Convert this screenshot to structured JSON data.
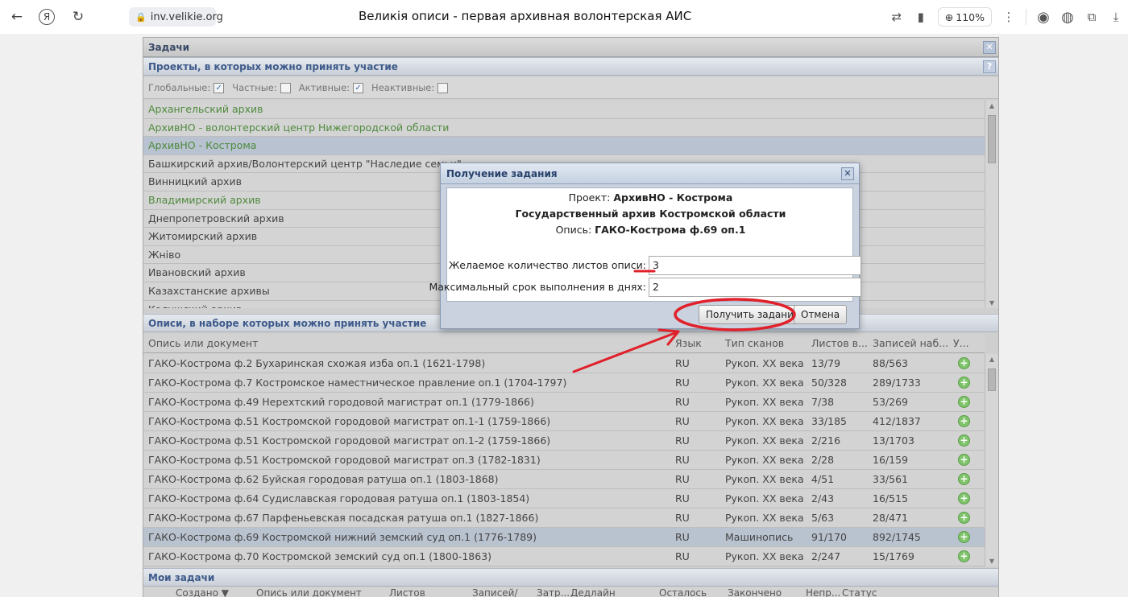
{
  "browser": {
    "back_glyph": "←",
    "yandex_glyph": "Я",
    "reload_glyph": "↻",
    "lock_glyph": "🔒",
    "url": "inv.velikie.org",
    "tab_title": "Великія описи - первая архивная волонтерская АИС",
    "zoom": "110%",
    "zoom_glyph": "⊕",
    "translate_glyph": "⇄",
    "bookmark_glyph": "▮",
    "menu_glyph": "⋮",
    "alice_glyph": "◉",
    "globe_glyph": "◍",
    "ext_glyph": "⧉",
    "download_glyph": "⤓"
  },
  "window": {
    "title": "Задачи",
    "close_glyph": "✕"
  },
  "projects_panel": {
    "title": "Проекты, в которых можно принять участие",
    "help_glyph": "?",
    "filters": [
      {
        "label": "Глобальные:",
        "checked": true
      },
      {
        "label": "Частные:",
        "checked": false
      },
      {
        "label": "Активные:",
        "checked": true
      },
      {
        "label": "Неактивные:",
        "checked": false
      }
    ],
    "check_glyph": "✓",
    "projects": [
      {
        "name": "Архангельский архив",
        "color": "green"
      },
      {
        "name": "АрхивНО - волонтерский центр Нижегородской области",
        "color": "green"
      },
      {
        "name": "АрхивНО - Кострома",
        "color": "green",
        "selected": true
      },
      {
        "name": "Башкирский архив/Волонтерский центр \"Наследие семьи\"",
        "color": "dark"
      },
      {
        "name": "Винницкий архив",
        "color": "dark"
      },
      {
        "name": "Владимирский архив",
        "color": "green"
      },
      {
        "name": "Днепропетровский архив",
        "color": "dark"
      },
      {
        "name": "Житомирский архив",
        "color": "dark"
      },
      {
        "name": "Жніво",
        "color": "dark"
      },
      {
        "name": "Ивановский архив",
        "color": "dark"
      },
      {
        "name": "Казахстанские архивы",
        "color": "dark"
      },
      {
        "name": "Калужский архив",
        "color": "dark"
      }
    ]
  },
  "inventories_panel": {
    "title": "Описи, в наборе которых можно принять участие",
    "columns": {
      "doc": "Опись или документ",
      "lang": "Язык",
      "scan": "Тип сканов",
      "sheets": "Листов в...",
      "records": "Записей наб...",
      "u": "У..."
    },
    "add_glyph": "+",
    "rows": [
      {
        "doc": "ГАКО-Кострома ф.2 Бухаринская схожая изба оп.1 (1621-1798)",
        "lang": "RU",
        "scan": "Рукоп. XX века",
        "sheets": "13/79",
        "records": "88/563"
      },
      {
        "doc": "ГАКО-Кострома ф.7 Костромское наместническое правление оп.1 (1704-1797)",
        "lang": "RU",
        "scan": "Рукоп. XX века",
        "sheets": "50/328",
        "records": "289/1733"
      },
      {
        "doc": "ГАКО-Кострома ф.49 Нерехтский городовой магистрат оп.1 (1779-1866)",
        "lang": "RU",
        "scan": "Рукоп. XX века",
        "sheets": "7/38",
        "records": "53/269"
      },
      {
        "doc": "ГАКО-Кострома ф.51 Костромской городовой магистрат оп.1-1 (1759-1866)",
        "lang": "RU",
        "scan": "Рукоп. XX века",
        "sheets": "33/185",
        "records": "412/1837"
      },
      {
        "doc": "ГАКО-Кострома ф.51 Костромской городовой магистрат оп.1-2 (1759-1866)",
        "lang": "RU",
        "scan": "Рукоп. XX века",
        "sheets": "2/216",
        "records": "13/1703"
      },
      {
        "doc": "ГАКО-Кострома ф.51 Костромской городовой магистрат оп.3 (1782-1831)",
        "lang": "RU",
        "scan": "Рукоп. XX века",
        "sheets": "2/28",
        "records": "16/159"
      },
      {
        "doc": "ГАКО-Кострома ф.62 Буйская городовая ратуша оп.1 (1803-1868)",
        "lang": "RU",
        "scan": "Рукоп. XX века",
        "sheets": "4/51",
        "records": "33/561"
      },
      {
        "doc": "ГАКО-Кострома ф.64 Судиславская городовая ратуша оп.1 (1803-1854)",
        "lang": "RU",
        "scan": "Рукоп. XX века",
        "sheets": "2/43",
        "records": "16/515"
      },
      {
        "doc": "ГАКО-Кострома ф.67 Парфеньевская посадская ратуша оп.1 (1827-1866)",
        "lang": "RU",
        "scan": "Рукоп. XX века",
        "sheets": "5/63",
        "records": "28/471"
      },
      {
        "doc": "ГАКО-Кострома ф.69 Костромской нижний земский суд оп.1 (1776-1789)",
        "lang": "RU",
        "scan": "Машинопись",
        "sheets": "91/170",
        "records": "892/1745",
        "selected": true
      },
      {
        "doc": "ГАКО-Кострома ф.70 Костромской земский суд оп.1 (1800-1863)",
        "lang": "RU",
        "scan": "Рукоп. XX века",
        "sheets": "2/247",
        "records": "15/1769"
      }
    ]
  },
  "my_tasks": {
    "title": "Мои задачи",
    "columns": [
      "Создано ▼",
      "Опись или документ",
      "Листов",
      "Записей/",
      "Затр...",
      "Дедлайн",
      "Осталось",
      "Закончено",
      "Непр...",
      "Статус"
    ]
  },
  "modal": {
    "title": "Получение задания",
    "close_glyph": "✕",
    "project_label": "Проект:",
    "project_value": "АрхивНО - Кострома",
    "archive": "Государственный архив Костромской области",
    "inventory_label": "Опись:",
    "inventory_value": "ГАКО-Кострома ф.69 оп.1",
    "sheets_label": "Желаемое количество листов описи:",
    "sheets_value": "3",
    "deadline_label": "Максимальный срок выполнения в днях:",
    "deadline_value": "2",
    "get_button": "Получить задание",
    "cancel_button": "Отмена"
  },
  "colors": {
    "annotation": "#e0202a",
    "link_green": "#4f8a3d",
    "panel_title": "#3d5a8a"
  }
}
